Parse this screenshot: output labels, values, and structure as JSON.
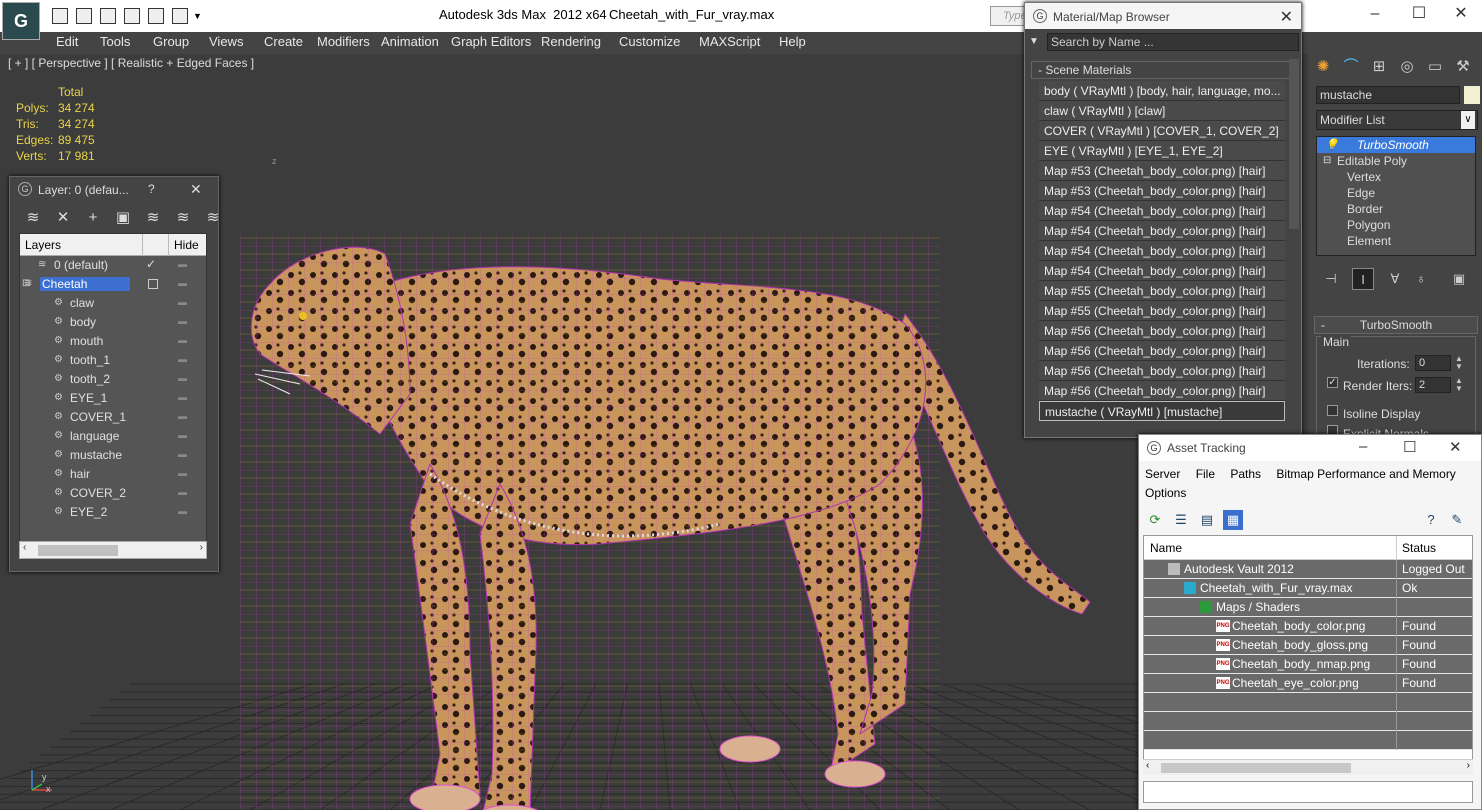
{
  "app": {
    "title": "Autodesk 3ds Max  2012 x64",
    "file": "Cheetah_with_Fur_vray.max",
    "title_search_placeholder": "Type",
    "colors": {
      "accent": "#3a7adc",
      "stats": "#e8d44a",
      "viewport_bg": "#3c3c3c"
    }
  },
  "menu": [
    "Edit",
    "Tools",
    "Group",
    "Views",
    "Create",
    "Modifiers",
    "Animation",
    "Graph Editors",
    "Rendering",
    "Customize",
    "MAXScript",
    "Help"
  ],
  "viewport": {
    "label": "[ + ] [ Perspective ] [ Realistic + Edged Faces ]",
    "axis_z": "z",
    "axis_x": "x",
    "axis_y": "y",
    "stats": {
      "header": "Total",
      "rows": [
        {
          "label": "Polys:",
          "value": "34 274"
        },
        {
          "label": "Tris:",
          "value": "34 274"
        },
        {
          "label": "Edges:",
          "value": "89 475"
        },
        {
          "label": "Verts:",
          "value": "17 981"
        }
      ]
    }
  },
  "layer_dialog": {
    "title": "Layer: 0 (defau...",
    "help": "?",
    "close": "✕",
    "col_layers": "Layers",
    "col_hide": "Hide",
    "rows": [
      {
        "name": "0 (default)",
        "level": 1,
        "check": "✓"
      },
      {
        "name": "Cheetah",
        "level": 0,
        "selected": true
      },
      {
        "name": "claw",
        "level": 2
      },
      {
        "name": "body",
        "level": 2
      },
      {
        "name": "mouth",
        "level": 2
      },
      {
        "name": "tooth_1",
        "level": 2
      },
      {
        "name": "tooth_2",
        "level": 2
      },
      {
        "name": "EYE_1",
        "level": 2
      },
      {
        "name": "COVER_1",
        "level": 2
      },
      {
        "name": "language",
        "level": 2
      },
      {
        "name": "mustache",
        "level": 2
      },
      {
        "name": "hair",
        "level": 2
      },
      {
        "name": "COVER_2",
        "level": 2
      },
      {
        "name": "EYE_2",
        "level": 2
      }
    ]
  },
  "material_browser": {
    "title": "Material/Map Browser",
    "search_placeholder": "Search by Name ...",
    "group": "- Scene Materials",
    "items": [
      "body  ( VRayMtl ) [body, hair, language, mo...",
      "claw  ( VRayMtl ) [claw]",
      "COVER  ( VRayMtl ) [COVER_1, COVER_2]",
      "EYE  ( VRayMtl ) [EYE_1, EYE_2]",
      "Map #53 (Cheetah_body_color.png)  [hair]",
      "Map #53 (Cheetah_body_color.png)  [hair]",
      "Map #54 (Cheetah_body_color.png)  [hair]",
      "Map #54 (Cheetah_body_color.png)  [hair]",
      "Map #54 (Cheetah_body_color.png)  [hair]",
      "Map #54 (Cheetah_body_color.png)  [hair]",
      "Map #55 (Cheetah_body_color.png)  [hair]",
      "Map #55 (Cheetah_body_color.png)  [hair]",
      "Map #56 (Cheetah_body_color.png)  [hair]",
      "Map #56 (Cheetah_body_color.png)  [hair]",
      "Map #56 (Cheetah_body_color.png)  [hair]",
      "Map #56 (Cheetah_body_color.png)  [hair]",
      "mustache  ( VRayMtl ) [mustache]"
    ]
  },
  "command_panel": {
    "object_name": "mustache",
    "modifier_list": "Modifier List",
    "stack": [
      {
        "name": "TurboSmooth",
        "selected": true
      },
      {
        "name": "Editable Poly"
      },
      {
        "name": "Vertex"
      },
      {
        "name": "Edge"
      },
      {
        "name": "Border"
      },
      {
        "name": "Polygon"
      },
      {
        "name": "Element"
      }
    ],
    "turbosmooth": {
      "header": "TurboSmooth",
      "group": "Main",
      "iterations_label": "Iterations:",
      "iterations_value": "0",
      "render_iters_label": "Render Iters:",
      "render_iters_value": "2",
      "isoline_label": "Isoline Display",
      "explicit_label": "Explicit Normals"
    }
  },
  "asset_tracking": {
    "title": "Asset Tracking",
    "menu": [
      "Server",
      "File",
      "Paths",
      "Bitmap Performance and Memory",
      "Options"
    ],
    "col_name": "Name",
    "col_status": "Status",
    "rows": [
      {
        "name": "Autodesk Vault 2012",
        "status": "Logged Out ...",
        "indent": 1,
        "icon": "vault-icon"
      },
      {
        "name": "Cheetah_with_Fur_vray.max",
        "status": "Ok",
        "indent": 2,
        "icon": "max-file-icon"
      },
      {
        "name": "Maps / Shaders",
        "status": "",
        "indent": 3,
        "icon": "maps-folder-icon"
      },
      {
        "name": "Cheetah_body_color.png",
        "status": "Found",
        "indent": 4,
        "icon": "png-icon"
      },
      {
        "name": "Cheetah_body_gloss.png",
        "status": "Found",
        "indent": 4,
        "icon": "png-icon"
      },
      {
        "name": "Cheetah_body_nmap.png",
        "status": "Found",
        "indent": 4,
        "icon": "png-icon"
      },
      {
        "name": "Cheetah_eye_color.png",
        "status": "Found",
        "indent": 4,
        "icon": "png-icon"
      }
    ],
    "png_badge": "PNG"
  }
}
